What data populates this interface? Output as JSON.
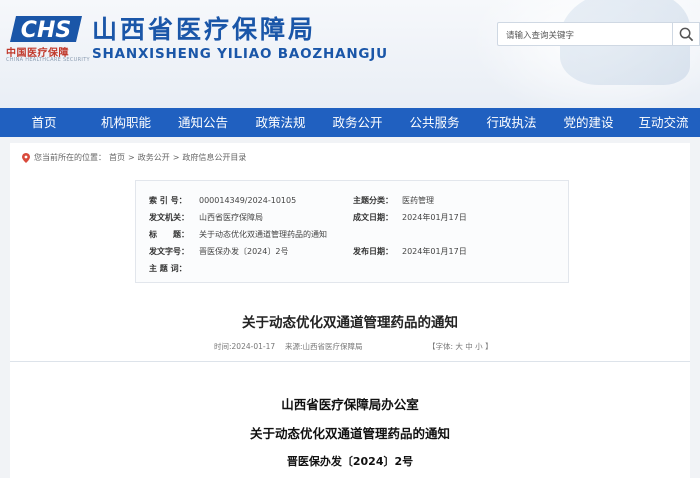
{
  "header": {
    "logo_mark_text": "CHS",
    "logo_cn": "中国医疗保障",
    "logo_en": "CHINA HEALTHCARE SECURITY",
    "site_title_cn": "山西省医疗保障局",
    "site_title_en": "SHANXISHENG YILIAO BAOZHANGJU",
    "search_placeholder": "请输入查询关键字"
  },
  "nav": {
    "items": [
      "首页",
      "机构职能",
      "通知公告",
      "政策法规",
      "政务公开",
      "公共服务",
      "行政执法",
      "党的建设",
      "互动交流"
    ]
  },
  "breadcrumb": {
    "prefix": "您当前所在的位置：",
    "items": [
      "首页",
      "政务公开",
      "政府信息公开目录"
    ],
    "separator": ">"
  },
  "meta": {
    "index_label": "索 引 号：",
    "index_value": "000014349/2024-10105",
    "topic_label": "主题分类：",
    "topic_value": "医药管理",
    "issuer_label": "发文机关：",
    "issuer_value": "山西省医疗保障局",
    "created_label": "成文日期：",
    "created_value": "2024年01月17日",
    "title_label": "标　　题：",
    "title_value": "关于动态优化双通道管理药品的通知",
    "docno_label": "发文字号：",
    "docno_value": "晋医保办发〔2024〕2号",
    "published_label": "发布日期：",
    "published_value": "2024年01月17日",
    "keywords_label": "主 题 词：",
    "keywords_value": ""
  },
  "article": {
    "title": "关于动态优化双通道管理药品的通知",
    "time": "时间:2024-01-17",
    "source": "来源:山西省医疗保障局",
    "font_size": "【字体: 大 中 小 】",
    "body_issuer": "山西省医疗保障局办公室",
    "body_title": "关于动态优化双通道管理药品的通知",
    "body_docno": "晋医保办发〔2024〕2号"
  },
  "colors": {
    "nav_bg": "#2060c0",
    "brand_blue": "#1a56a8",
    "logo_red": "#c0392b"
  }
}
